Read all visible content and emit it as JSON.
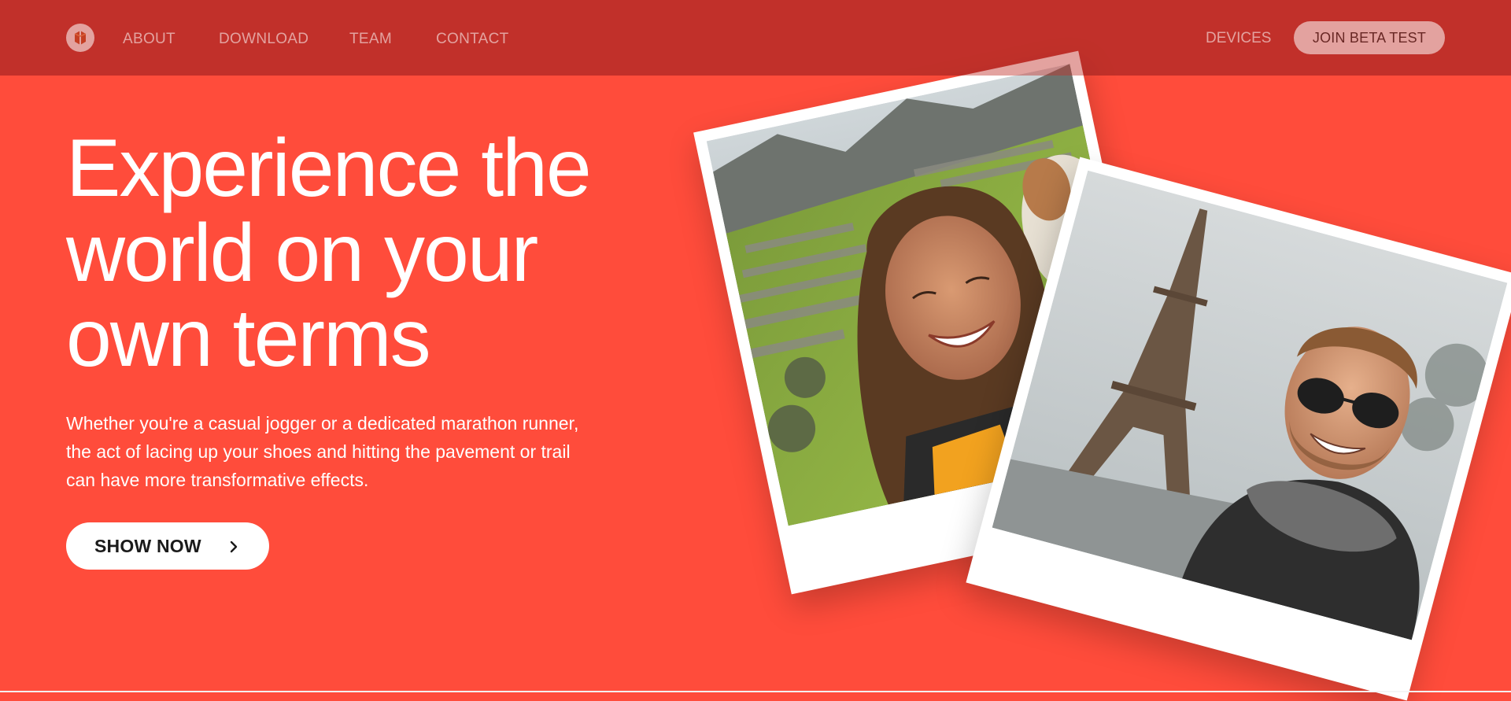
{
  "header": {
    "logo_icon": "brand-logo-icon",
    "nav": [
      {
        "label": "ABOUT"
      },
      {
        "label": "DOWNLOAD"
      },
      {
        "label": "TEAM"
      },
      {
        "label": "CONTACT"
      }
    ],
    "devices_label": "DEVICES",
    "beta_button": "JOIN BETA TEST"
  },
  "hero": {
    "title": "Experience the world on your own terms",
    "description": "Whether you're a casual jogger or a dedicated marathon runner, the act of lacing up your shoes and hitting the pavement or trail can have more transformative effects.",
    "cta_label": "SHOW NOW",
    "cta_icon": "chevron-right-icon"
  },
  "colors": {
    "background": "#ff4c3b",
    "header": "#c1312a",
    "button": "#ffffff"
  },
  "photos": [
    {
      "name": "woman-selfie-machu-picchu-photo"
    },
    {
      "name": "man-selfie-eiffel-tower-photo"
    }
  ]
}
